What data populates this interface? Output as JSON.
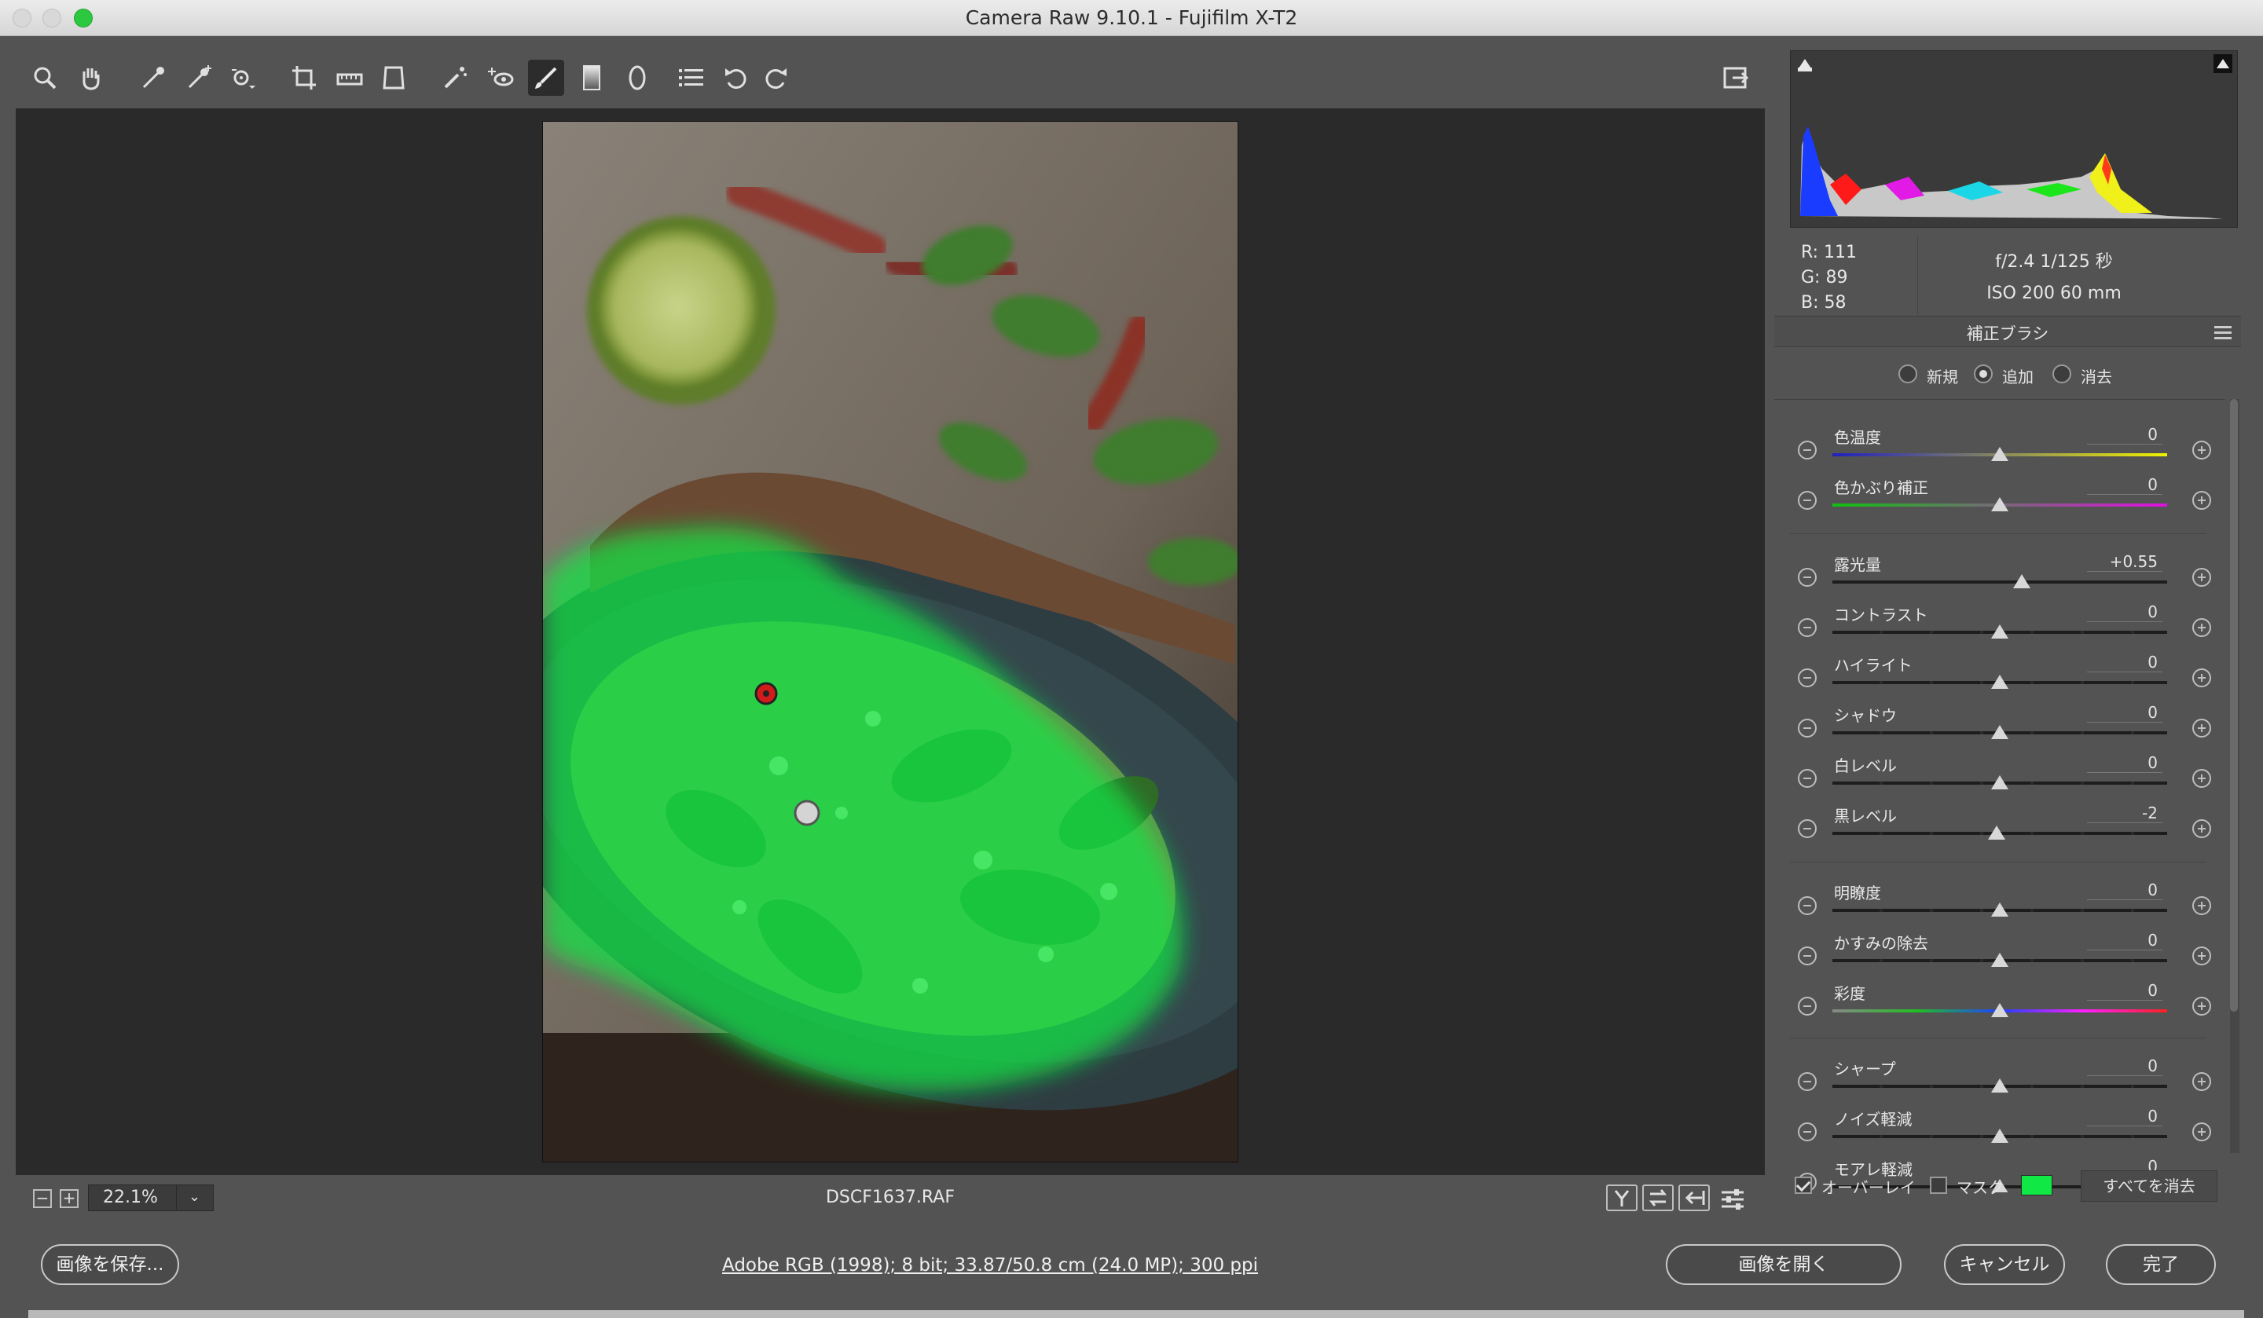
{
  "window": {
    "title": "Camera Raw 9.10.1  -  Fujifilm X-T2"
  },
  "toolbar": {
    "tools": [
      "zoom-tool",
      "hand-tool",
      "white-balance-tool",
      "color-sampler-tool",
      "target-adjustment-tool",
      "crop-tool",
      "straighten-tool",
      "transform-tool",
      "spot-removal-tool",
      "red-eye-tool",
      "adjustment-brush-tool",
      "graduated-filter-tool",
      "radial-filter-tool",
      "preferences-list-tool",
      "rotate-left-tool",
      "rotate-right-tool"
    ],
    "active_tool": "adjustment-brush-tool"
  },
  "preview": {
    "zoom": "22.1%",
    "filename": "DSCF1637.RAF",
    "overlay_color": "#10e845"
  },
  "histogram": {
    "r": "R:  111",
    "g": "G:  89",
    "b": "B:  58"
  },
  "camera_info": {
    "line1": "f/2.4   1/125 秒",
    "line2": "ISO 200   60 mm"
  },
  "panel": {
    "title": "補正ブラシ",
    "modes": [
      {
        "label": "新規"
      },
      {
        "label": "追加"
      },
      {
        "label": "消去"
      }
    ],
    "selected_mode": "追加",
    "sliders": [
      {
        "label": "色温度",
        "value": "0",
        "pos": 0.5
      },
      {
        "label": "色かぶり補正",
        "value": "0",
        "pos": 0.5
      },
      {
        "label": "露光量",
        "value": "+0.55",
        "pos": 0.565
      },
      {
        "label": "コントラスト",
        "value": "0",
        "pos": 0.5
      },
      {
        "label": "ハイライト",
        "value": "0",
        "pos": 0.5
      },
      {
        "label": "シャドウ",
        "value": "0",
        "pos": 0.5
      },
      {
        "label": "白レベル",
        "value": "0",
        "pos": 0.5
      },
      {
        "label": "黒レベル",
        "value": "-2",
        "pos": 0.49
      },
      {
        "label": "明瞭度",
        "value": "0",
        "pos": 0.5
      },
      {
        "label": "かすみの除去",
        "value": "0",
        "pos": 0.5
      },
      {
        "label": "彩度",
        "value": "0",
        "pos": 0.5
      },
      {
        "label": "シャープ",
        "value": "0",
        "pos": 0.5
      },
      {
        "label": "ノイズ軽減",
        "value": "0",
        "pos": 0.5
      },
      {
        "label": "モアレ軽減",
        "value": "0",
        "pos": 0.5
      }
    ]
  },
  "overlay_controls": {
    "overlay_label": "オーバーレイ",
    "mask_label": "マスク",
    "clear_all": "すべてを消去"
  },
  "bottom": {
    "save_label": "画像を保存...",
    "workflow": "Adobe RGB (1998); 8 bit; 33.87/50.8 cm (24.0 MP); 300 ppi",
    "open_label": "画像を開く",
    "cancel_label": "キャンセル",
    "done_label": "完了"
  }
}
